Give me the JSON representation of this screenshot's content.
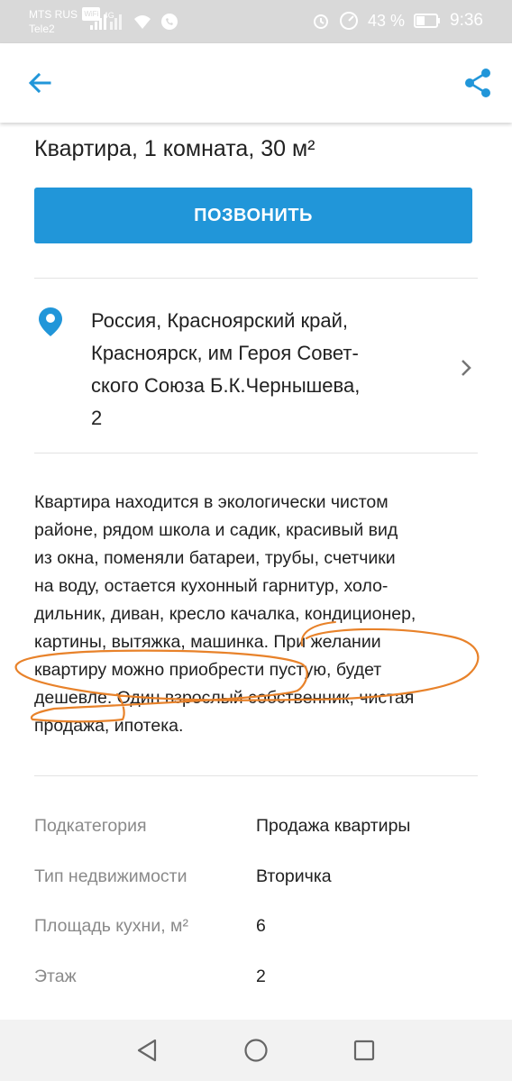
{
  "status_bar": {
    "operator1": "MTS RUS",
    "operator1_badge": "WiFi",
    "network": "4G",
    "operator2": "Tele2",
    "battery_percent": "43 %",
    "battery_level": 0.43,
    "time": "9:36"
  },
  "app_bar": {
    "back_icon": "arrow-left-icon",
    "share_icon": "share-icon",
    "accent_color": "#2196d9"
  },
  "listing": {
    "title": "Квартира, 1 комната, 30 м²",
    "call_button": "ПОЗВОНИТЬ",
    "address_lines": [
      "Россия, Красноярский край,",
      "Красноярск, им Героя Совет-",
      "ского Союза Б.К.Чернышева,",
      "2"
    ],
    "description_lines": [
      "Квартира находится в экологически чистом",
      "районе, рядом школа и садик, красивый вид",
      "из окна, поменяли батареи, трубы, счетчики",
      "на воду, остается кухонный гарнитур, холо-",
      "дильник, диван, кресло качалка, кондиционер,",
      "картины, вытяжка, машинка. При желании",
      "квартиру можно приобрести пустую, будет",
      "дешевле. Один взрослый собственник, чистая",
      "продажа, ипотека."
    ]
  },
  "properties": [
    {
      "key": "Подкатегория",
      "value": "Продажа квартиры"
    },
    {
      "key": "Тип недвижимости",
      "value": "Вторичка"
    },
    {
      "key": "Площадь кухни, м²",
      "value": "6"
    },
    {
      "key": "Этаж",
      "value": "2"
    }
  ],
  "nav_bar": {
    "back": "triangle-back-icon",
    "home": "circle-home-icon",
    "recents": "square-recents-icon"
  },
  "annotation_color": "#e8822a"
}
